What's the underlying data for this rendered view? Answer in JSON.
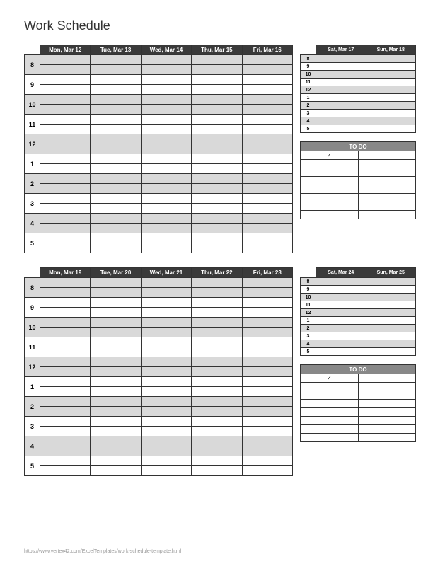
{
  "title": "Work Schedule",
  "hours": [
    "8",
    "9",
    "10",
    "11",
    "12",
    "1",
    "2",
    "3",
    "4",
    "5"
  ],
  "shade_hours": [
    "8",
    "10",
    "12",
    "2",
    "4"
  ],
  "weeks": [
    {
      "weekday_headers": [
        "Mon, Mar 12",
        "Tue, Mar 13",
        "Wed, Mar 14",
        "Thu, Mar 15",
        "Fri, Mar 16"
      ],
      "weekend_headers": [
        "Sat, Mar 17",
        "Sun, Mar 18"
      ]
    },
    {
      "weekday_headers": [
        "Mon, Mar 19",
        "Tue, Mar 20",
        "Wed, Mar 21",
        "Thu, Mar 22",
        "Fri, Mar 23"
      ],
      "weekend_headers": [
        "Sat, Mar 24",
        "Sun, Mar 25"
      ]
    }
  ],
  "todo": {
    "header": "TO DO",
    "check": "✓",
    "rows": 8
  },
  "footer_url": "https://www.vertex42.com/ExcelTemplates/work-schedule-template.html"
}
